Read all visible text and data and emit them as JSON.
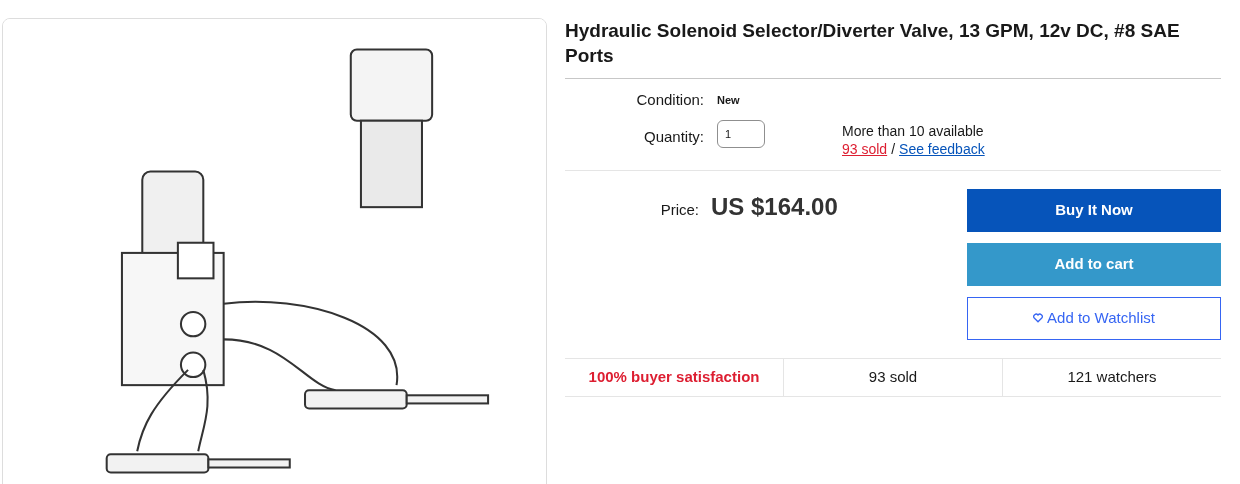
{
  "title": "Hydraulic Solenoid Selector/Diverter Valve, 13 GPM, 12v DC, #8 SAE Ports",
  "condition": {
    "label": "Condition:",
    "value": "New"
  },
  "quantity": {
    "label": "Quantity:",
    "value": "1",
    "availability": "More than 10 available",
    "sold_link": "93 sold",
    "separator": "/",
    "feedback_link": "See feedback"
  },
  "price": {
    "label": "Price:",
    "value": "US $164.00"
  },
  "buttons": [
    {
      "kind": "primary",
      "label": "Buy It Now"
    },
    {
      "kind": "secondary",
      "label": "Add to cart"
    },
    {
      "kind": "outline",
      "label": "Add to Watchlist"
    }
  ],
  "stats": [
    {
      "kind": "highlight",
      "text": "100% buyer satisfaction"
    },
    {
      "kind": "plain",
      "text": "93 sold"
    },
    {
      "kind": "plain",
      "text": "121 watchers"
    }
  ]
}
